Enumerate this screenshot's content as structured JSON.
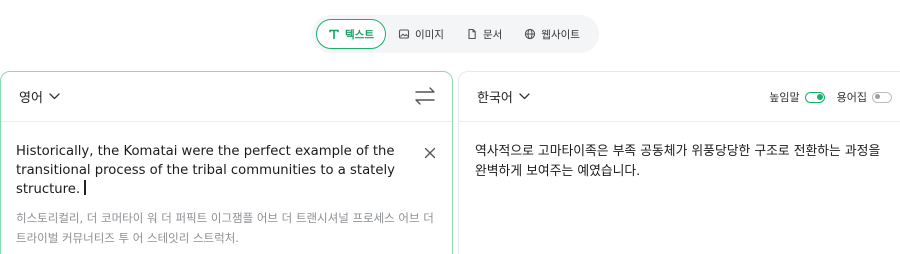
{
  "tabs": [
    {
      "label": "텍스트",
      "icon": "text-t-icon",
      "active": true
    },
    {
      "label": "이미지",
      "icon": "image-icon",
      "active": false
    },
    {
      "label": "문서",
      "icon": "document-icon",
      "active": false
    },
    {
      "label": "웹사이트",
      "icon": "globe-icon",
      "active": false
    }
  ],
  "source": {
    "language": "영어",
    "text": "Historically, the Komatai were the perfect example of the transitional process of the tribal communities to a stately structure.",
    "romanization": "히스토리컬리, 더 코머타이 워 더 퍼픽트 이그잼플 어브 더 트랜시셔널 프로세스 어브 더 트라이벌 커뮤너티즈 투 어 스테잇리 스트럭처."
  },
  "target": {
    "language": "한국어",
    "text": "역사적으로 고마타이족은 부족 공동체가 위풍당당한 구조로 전환하는 과정을 완벽하게 보여주는 예였습니다.",
    "honorific_label": "높임말",
    "honorific_on": true,
    "glossary_label": "용어집",
    "glossary_on": false
  },
  "colors": {
    "accent": "#19b06b",
    "accent_text": "#13a160",
    "source_border": "#8fd9b0",
    "muted_text": "#8d9094"
  }
}
